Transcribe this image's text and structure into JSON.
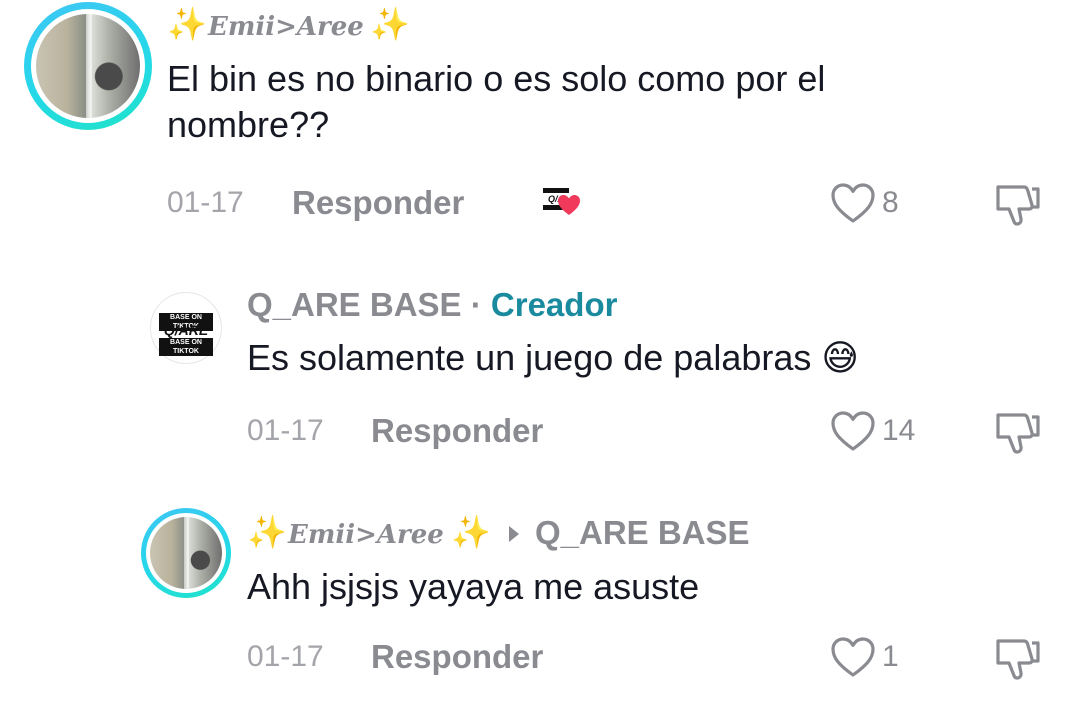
{
  "comments": [
    {
      "username": "Emii>Aree",
      "text": "El bin es no binario o es solo como por el nombre??",
      "date": "01-17",
      "reply_label": "Responder",
      "likes": "8"
    },
    {
      "username": "Q_ARE BASE",
      "separator": "·",
      "badge": "Creador",
      "text": "Es solamente un juego de palabras",
      "emoji": "😅",
      "date": "01-17",
      "reply_label": "Responder",
      "likes": "14"
    },
    {
      "username": "Emii>Aree",
      "reply_to": "Q_ARE BASE",
      "text": "Ahh jsjsjs yayaya me asuste",
      "date": "01-17",
      "reply_label": "Responder",
      "likes": "1"
    }
  ],
  "logo": {
    "top": "BASE ON TIKTOK",
    "mid": "Q/ARE",
    "bottom": "BASE ON TIKTOK"
  },
  "icons": {
    "sparkle": "sparkles-icon",
    "heart": "heart-outline-icon",
    "dislike": "thumbs-down-icon",
    "arrow": "reply-arrow-icon"
  },
  "colors": {
    "creator_badge": "#1a8a9e",
    "avatar_ring": "#25d8e8",
    "liked_heart": "#f0395b"
  }
}
